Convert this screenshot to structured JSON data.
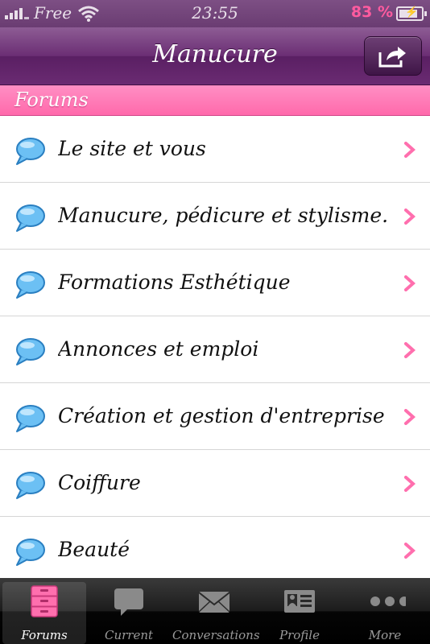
{
  "status_bar": {
    "carrier": "Free",
    "time": "23:55",
    "battery_percent_label": "83 %",
    "battery_level": 0.83
  },
  "nav": {
    "title": "Manucure"
  },
  "section": {
    "title": "Forums"
  },
  "forums": [
    {
      "label": "Le site et vous"
    },
    {
      "label": "Manucure, pédicure et stylisme..."
    },
    {
      "label": "Formations Esthétique"
    },
    {
      "label": "Annonces et emploi"
    },
    {
      "label": "Création et gestion d'entreprise"
    },
    {
      "label": "Coiffure"
    },
    {
      "label": "Beauté"
    }
  ],
  "tabs": [
    {
      "label": "Forums",
      "icon": "drawer-icon",
      "selected": true
    },
    {
      "label": "Current",
      "icon": "speech-bubble-icon",
      "selected": false
    },
    {
      "label": "Conversations",
      "icon": "envelope-icon",
      "selected": false
    },
    {
      "label": "Profile",
      "icon": "id-card-icon",
      "selected": false
    },
    {
      "label": "More",
      "icon": "more-icon",
      "selected": false
    }
  ],
  "colors": {
    "nav_purple": "#6b2e74",
    "section_pink": "#ff7ab6",
    "accent_pink": "#ff5b9f",
    "bubble_blue": "#5ab4ee"
  }
}
